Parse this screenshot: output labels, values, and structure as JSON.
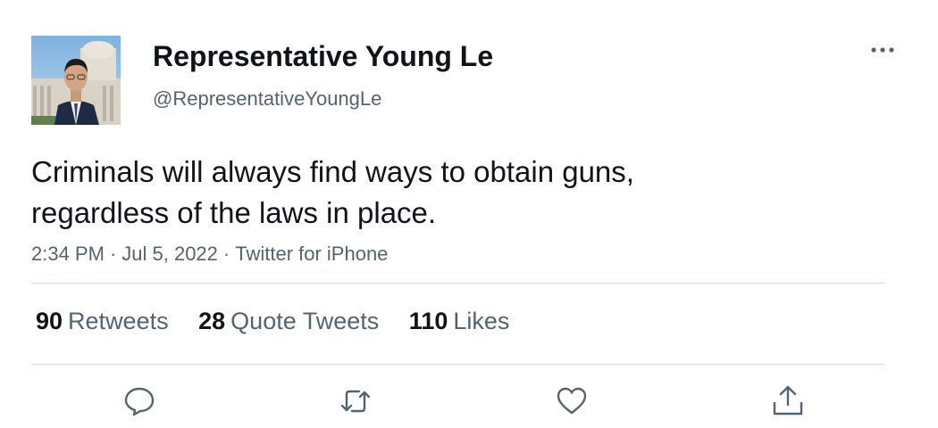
{
  "tweet": {
    "author": {
      "display_name": "Representative Young Le",
      "handle": "@RepresentativeYoungLe",
      "avatar": "profile-photo-capitol"
    },
    "text_lines": [
      "Criminals will always find ways to obtain guns,",
      "regardless of the laws in place."
    ],
    "meta": {
      "time": "2:34 PM",
      "date": "Jul 5, 2022",
      "source": "Twitter for iPhone",
      "separator": "·"
    },
    "stats": {
      "retweets": {
        "count": "90",
        "label": "Retweets"
      },
      "quote_tweets": {
        "count": "28",
        "label": "Quote Tweets"
      },
      "likes": {
        "count": "110",
        "label": "Likes"
      }
    },
    "actions": [
      "reply-icon",
      "retweet-icon",
      "like-icon",
      "share-icon"
    ],
    "more_icon": "more-options-icon"
  },
  "colors": {
    "primary_text": "#0f1419",
    "secondary_text": "#536471",
    "divider": "#cfd9de"
  }
}
